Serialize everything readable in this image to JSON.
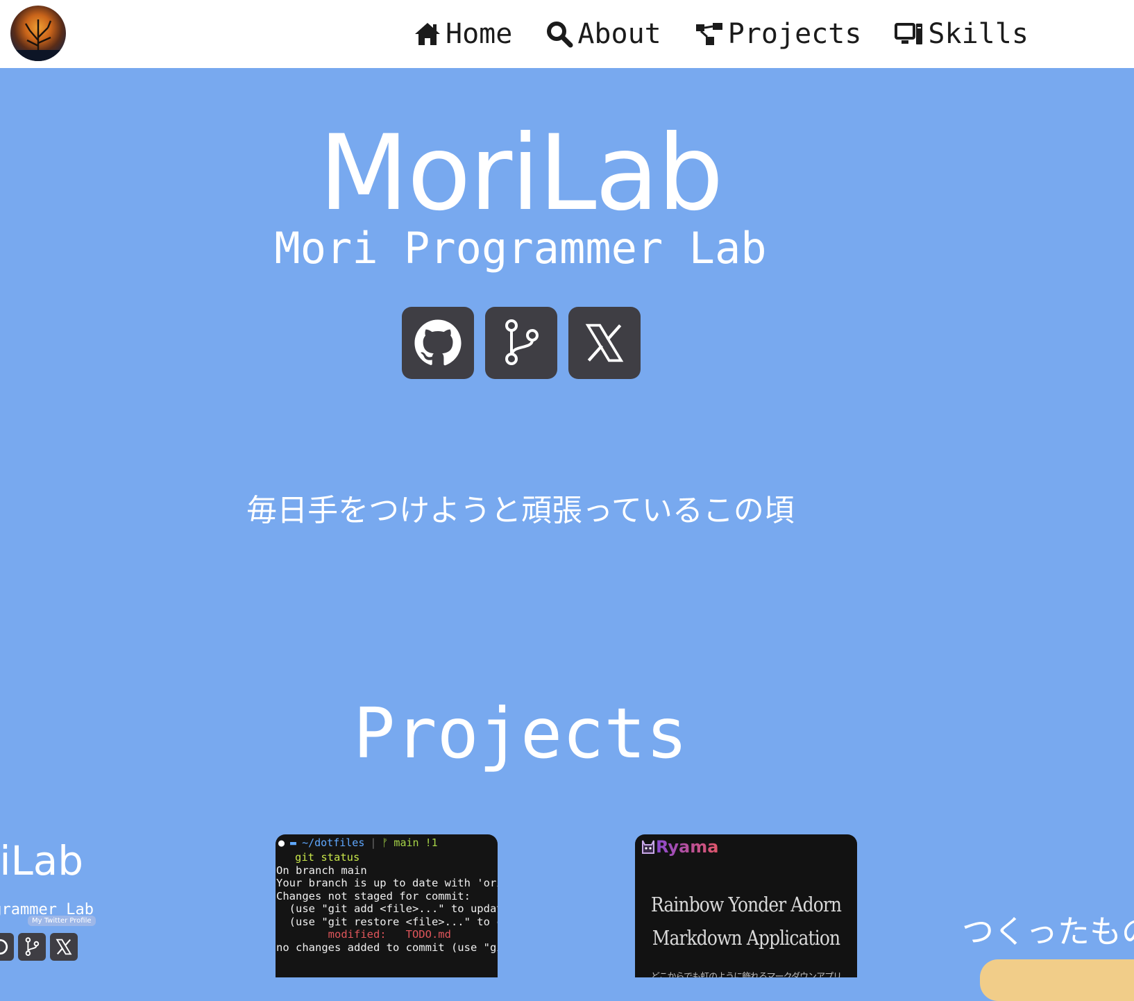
{
  "nav": {
    "items": [
      {
        "label": "Home",
        "icon": "home-icon"
      },
      {
        "label": "About",
        "icon": "search-icon"
      },
      {
        "label": "Projects",
        "icon": "sitemap-icon"
      },
      {
        "label": "Skills",
        "icon": "desktop-icon"
      }
    ]
  },
  "hero": {
    "title": "MoriLab",
    "subtitle": "Mori Programmer Lab",
    "socials": [
      {
        "icon": "github-icon"
      },
      {
        "icon": "git-branch-icon"
      },
      {
        "icon": "x-icon"
      }
    ],
    "tagline": "毎日手をつけようと頑張っているこの頃"
  },
  "projects": {
    "heading": "Projects",
    "left_thumb": {
      "title": "oriLab",
      "subtitle": "ogrammer Lab",
      "tooltip": "My Twitter Profile"
    },
    "terminal_card": {
      "path": "~/dotfiles",
      "branch": "main !1",
      "command": "git status",
      "lines": [
        "On branch main",
        "Your branch is up to date with 'ori",
        "",
        "Changes not staged for commit:",
        "  (use \"git add <file>...\" to updat",
        "  (use \"git restore <file>...\" to c",
        "        modified:   TODO.md",
        "",
        "no changes added to commit (use \"gi"
      ]
    },
    "ryama_card": {
      "brand": "Ryama",
      "line1": "Rainbow Yonder Adorn",
      "line2": "Markdown Application",
      "caption": "どこからでも虹のように飾れるマークダウンアプリ"
    },
    "right_card_text": "つくったもの"
  },
  "colors": {
    "background": "#78a9ef",
    "nav_background": "#ffffff",
    "social_button": "#3f3e44",
    "accent_button": "#f1cd89"
  }
}
